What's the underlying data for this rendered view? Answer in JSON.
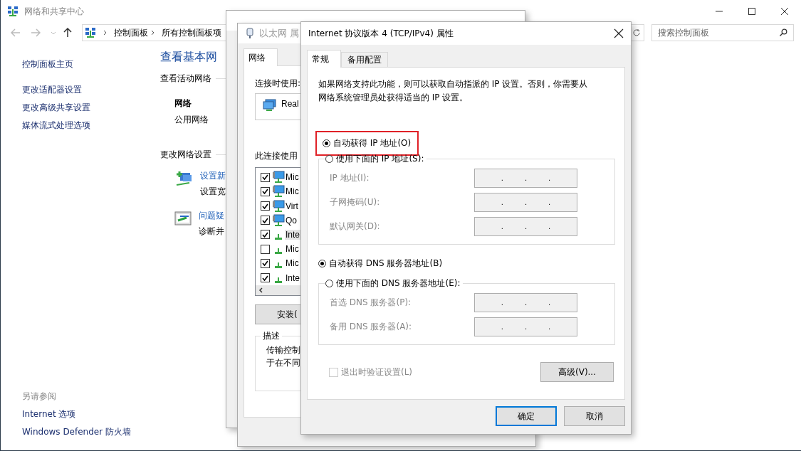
{
  "main_window": {
    "title": "网络和共享中心",
    "breadcrumb": [
      "控制面板",
      "所有控制面板项"
    ],
    "search": {
      "placeholder": "搜索控制面板"
    },
    "sidebar": {
      "items": [
        "控制面板主页",
        "更改适配器设置",
        "更改高级共享设置",
        "媒体流式处理选项"
      ],
      "see_also_heading": "另请参阅",
      "see_also": [
        "Internet 选项",
        "Windows Defender 防火墙"
      ]
    },
    "heading": "查看基本网",
    "active_networks_heading": "查看活动网络",
    "network_name": "网络",
    "network_type": "公用网络",
    "change_settings_heading": "更改网络设置",
    "tasks": [
      {
        "kind": "new-connection",
        "link": "设置新",
        "description": "设置宽"
      },
      {
        "kind": "troubleshoot",
        "link": "问题疑",
        "description": "诊断并"
      }
    ]
  },
  "properties_window": {
    "title": "以太网 属",
    "tabs": [
      {
        "label": "网络",
        "selected": true
      }
    ],
    "connect_using_label": "连接时使用:",
    "adapter": "Real",
    "components_label": "此连接使用",
    "components": [
      {
        "kind": "client",
        "label": "Mic",
        "checked": true,
        "selected": false
      },
      {
        "kind": "client",
        "label": "Mic",
        "checked": true,
        "selected": false
      },
      {
        "kind": "client",
        "label": "Virt",
        "checked": true,
        "selected": false
      },
      {
        "kind": "client",
        "label": "Qo",
        "checked": true,
        "selected": false
      },
      {
        "kind": "protocol",
        "label": "Inte",
        "checked": true,
        "selected": true
      },
      {
        "kind": "protocol",
        "label": "Mic",
        "checked": false,
        "selected": false
      },
      {
        "kind": "protocol",
        "label": "Mic",
        "checked": true,
        "selected": false
      },
      {
        "kind": "protocol",
        "label": "Inte",
        "checked": true,
        "selected": false
      }
    ],
    "install_button": "安装(",
    "description_heading": "描述",
    "description_lines": [
      "传输控制",
      "于在不同"
    ]
  },
  "ipv4_dialog": {
    "title": "Internet 协议版本 4 (TCP/IPv4) 属性",
    "tabs": [
      {
        "label": "常规",
        "selected": true
      },
      {
        "label": "备用配置",
        "selected": false
      }
    ],
    "intro": "如果网络支持此功能，则可以获取自动指派的 IP 设置。否则，你需要从网络系统管理员处获得适当的 IP 设置。",
    "ip_auto": {
      "label": "自动获得 IP 地址(O)",
      "selected": true,
      "highlighted": true
    },
    "ip_manual": {
      "label": "使用下面的 IP 地址(S):",
      "selected": false,
      "highlighted": false
    },
    "ip_fields": [
      {
        "label": "IP 地址(I):",
        "segments": [
          ".",
          ".",
          "."
        ],
        "disabled": true
      },
      {
        "label": "子网掩码(U):",
        "segments": [
          ".",
          ".",
          "."
        ],
        "disabled": true
      },
      {
        "label": "默认网关(D):",
        "segments": [
          ".",
          ".",
          "."
        ],
        "disabled": true
      }
    ],
    "dns_auto": {
      "label": "自动获得 DNS 服务器地址(B)",
      "selected": true,
      "highlighted": false
    },
    "dns_manual": {
      "label": "使用下面的 DNS 服务器地址(E):",
      "selected": false,
      "highlighted": false
    },
    "dns_fields": [
      {
        "label": "首选 DNS 服务器(P):",
        "segments": [
          ".",
          ".",
          "."
        ],
        "disabled": true
      },
      {
        "label": "备用 DNS 服务器(A):",
        "segments": [
          ".",
          ".",
          "."
        ],
        "disabled": true
      }
    ],
    "validate_checkbox": {
      "label": "退出时验证设置(L)",
      "checked": false,
      "disabled": true
    },
    "advanced_button": "高级(V)...",
    "buttons": [
      {
        "label": "确定",
        "default": true
      },
      {
        "label": "取消",
        "default": false
      }
    ]
  }
}
